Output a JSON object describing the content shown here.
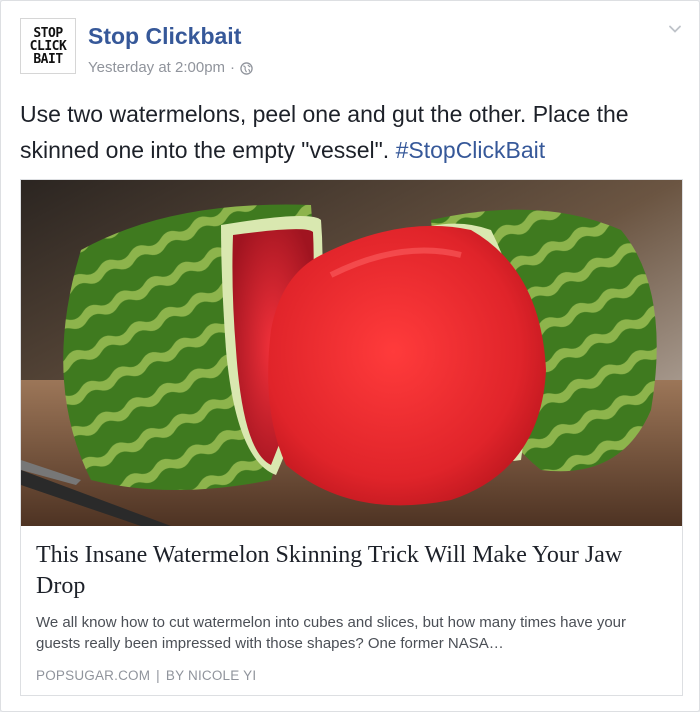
{
  "post": {
    "page_name": "Stop Clickbait",
    "avatar_lines": [
      "STOP",
      "CLICK",
      "BAIT"
    ],
    "timestamp": "Yesterday at 2:00pm",
    "separator": "·",
    "icons": {
      "privacy": "globe-icon",
      "menu": "chevron-down-icon"
    },
    "message_text": "Use two watermelons, peel one and gut the other. Place the skinned one into the empty \"vessel\". ",
    "hashtag": "#StopClickBait"
  },
  "link_card": {
    "title": "This Insane Watermelon Skinning Trick Will Make Your Jaw Drop",
    "description": "We all know how to cut watermelon into cubes and slices, but how many times have your guests really been impressed with those shapes? One former NASA…",
    "source": "POPSUGAR.COM",
    "separator": "|",
    "byline": "BY NICOLE YI"
  },
  "colors": {
    "link_blue": "#365899",
    "text": "#1d2129",
    "muted": "#90949c"
  }
}
